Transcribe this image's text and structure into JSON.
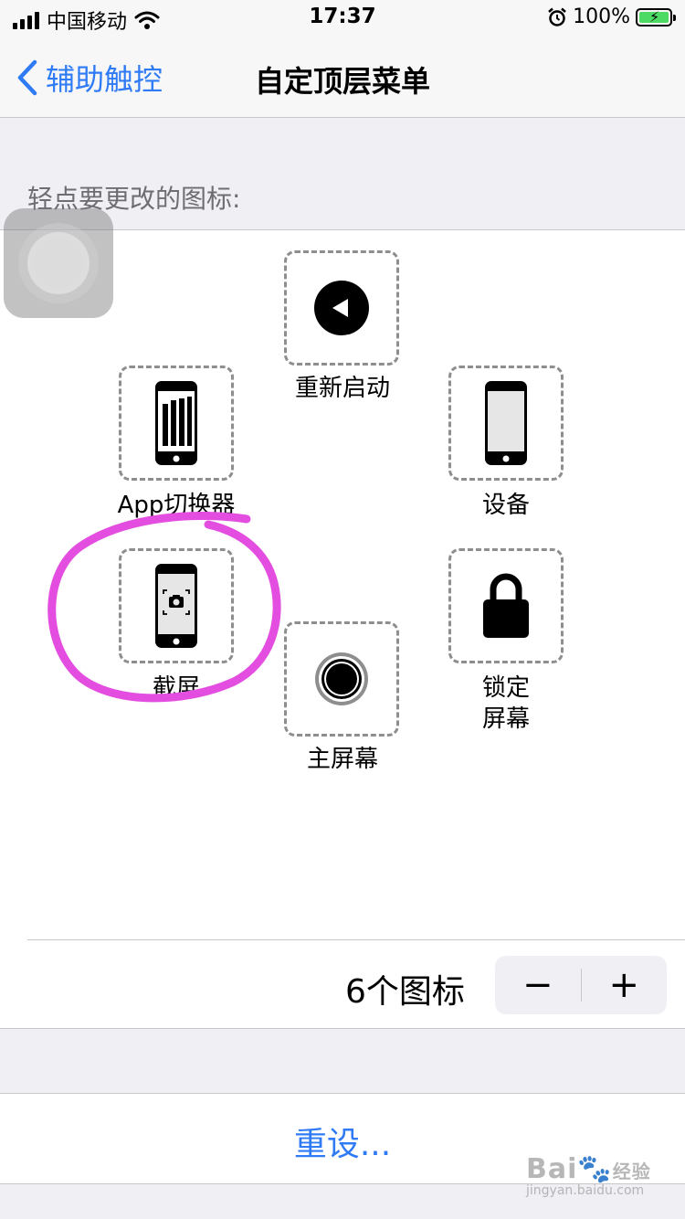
{
  "status_bar": {
    "carrier": "中国移动",
    "time": "17:37",
    "battery": "100%",
    "icons": [
      "signal-icon",
      "wifi-icon",
      "alarm-icon",
      "battery-icon"
    ]
  },
  "nav": {
    "back_label": "辅助触控",
    "title": "自定顶层菜单"
  },
  "section_label": "轻点要更改的图标:",
  "icons": [
    {
      "label": "重新启动",
      "icon": "restart-icon"
    },
    {
      "label": "App切换器",
      "icon": "app-switcher-icon"
    },
    {
      "label": "设备",
      "icon": "device-icon"
    },
    {
      "label": "截屏",
      "icon": "screenshot-icon"
    },
    {
      "label": "锁定\n屏幕",
      "icon": "lock-icon"
    },
    {
      "label": "主屏幕",
      "icon": "home-icon"
    }
  ],
  "icon_count": {
    "label": "6个图标",
    "minus": "−",
    "plus": "+"
  },
  "reset_label": "重设...",
  "watermark": {
    "main": "Bai",
    "badge": "经验",
    "sub": "jingyan.baidu.com"
  },
  "colors": {
    "accent": "#2f7bf5",
    "highlight": "#e34ee0",
    "battery": "#4cd964"
  }
}
